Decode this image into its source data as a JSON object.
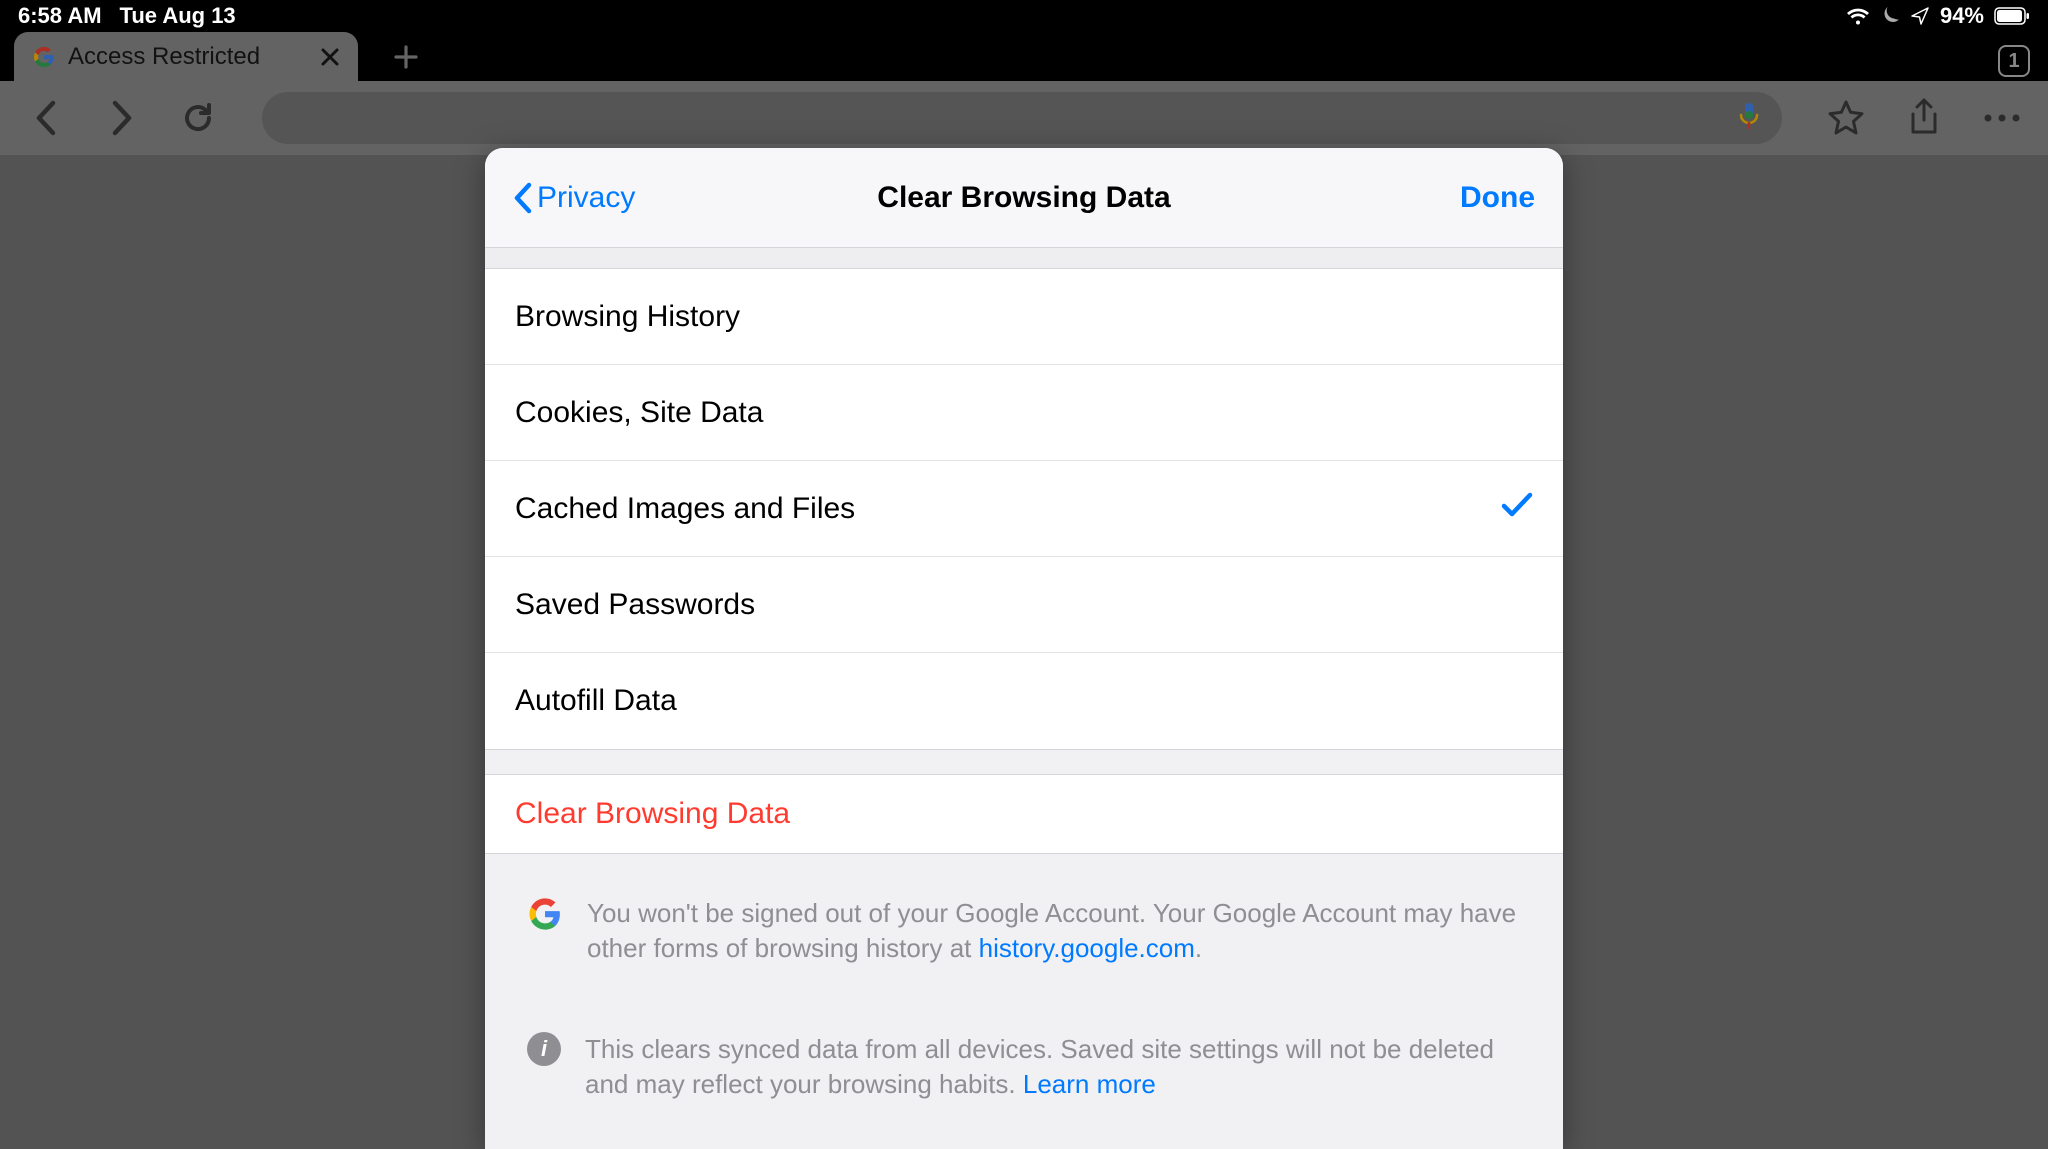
{
  "status": {
    "time": "6:58 AM",
    "date": "Tue Aug 13",
    "battery_pct": "94%"
  },
  "tabs": {
    "active": {
      "title": "Access Restricted"
    },
    "count": "1"
  },
  "modal": {
    "back_label": "Privacy",
    "title": "Clear Browsing Data",
    "done_label": "Done",
    "options": [
      {
        "label": "Browsing History",
        "checked": false
      },
      {
        "label": "Cookies, Site Data",
        "checked": false
      },
      {
        "label": "Cached Images and Files",
        "checked": true
      },
      {
        "label": "Saved Passwords",
        "checked": false
      },
      {
        "label": "Autofill Data",
        "checked": false
      }
    ],
    "action_label": "Clear Browsing Data",
    "note1_pre": "You won't be signed out of your Google Account. Your Google Account may have other forms of browsing history at ",
    "note1_link": "history.google.com",
    "note1_post": ".",
    "note2_pre": "This clears synced data from all devices. Saved site settings will not be deleted and may reflect your browsing habits. ",
    "note2_link": "Learn more"
  }
}
